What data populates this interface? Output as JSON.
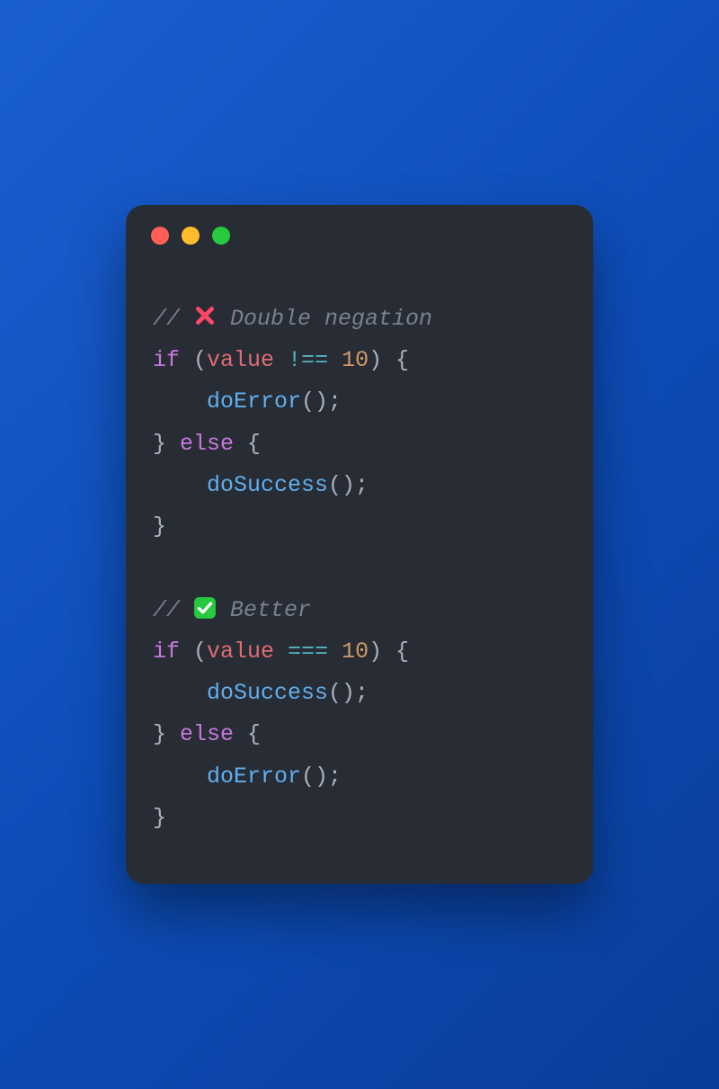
{
  "code": {
    "block1": {
      "commentPrefix": "// ",
      "commentText": " Double negation",
      "line1_if": "if",
      "line1_openParen": " (",
      "line1_var": "value",
      "line1_space1": " ",
      "line1_op": "!==",
      "line1_space2": " ",
      "line1_num": "10",
      "line1_closeParen": ") {",
      "line2_indent": "    ",
      "line2_fn": "doError",
      "line2_call": "();",
      "line3_close": "} ",
      "line3_else": "else",
      "line3_open": " {",
      "line4_indent": "    ",
      "line4_fn": "doSuccess",
      "line4_call": "();",
      "line5_close": "}"
    },
    "block2": {
      "commentPrefix": "// ",
      "commentText": " Better",
      "line1_if": "if",
      "line1_openParen": " (",
      "line1_var": "value",
      "line1_space1": " ",
      "line1_op": "===",
      "line1_space2": " ",
      "line1_num": "10",
      "line1_closeParen": ") {",
      "line2_indent": "    ",
      "line2_fn": "doSuccess",
      "line2_call": "();",
      "line3_close": "} ",
      "line3_else": "else",
      "line3_open": " {",
      "line4_indent": "    ",
      "line4_fn": "doError",
      "line4_call": "();",
      "line5_close": "}"
    }
  }
}
